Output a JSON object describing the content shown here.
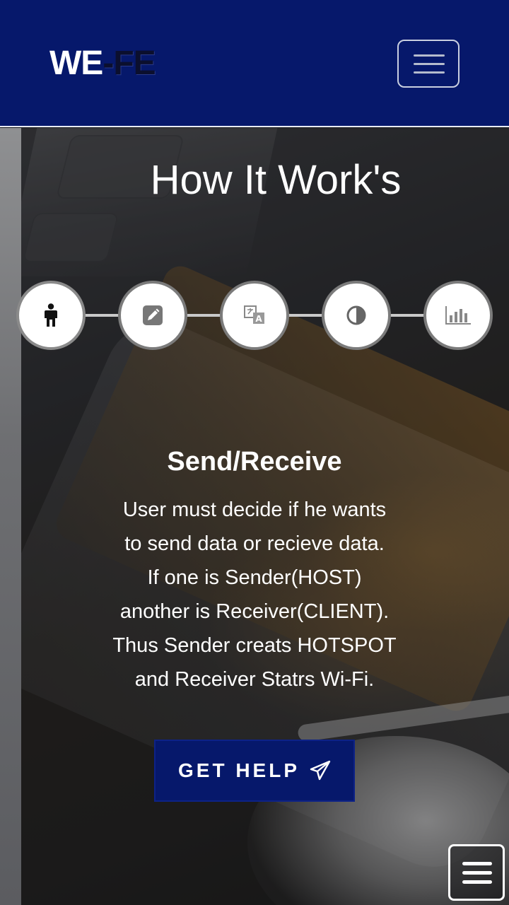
{
  "navbar": {
    "brand_we": "WE",
    "brand_dash": "-",
    "brand_fe": "FE",
    "menu_icon": "hamburger-menu-icon"
  },
  "section": {
    "title": "How It Work's"
  },
  "steps": [
    {
      "icon": "person-icon",
      "active": true
    },
    {
      "icon": "edit-icon",
      "active": false
    },
    {
      "icon": "translate-icon",
      "active": false
    },
    {
      "icon": "contrast-icon",
      "active": false
    },
    {
      "icon": "bar-chart-icon",
      "active": false
    }
  ],
  "active_step": {
    "heading": "Send/Receive",
    "lines": [
      "User must decide if he wants",
      "to send data or recieve data.",
      "If one is Sender(HOST)",
      "another is Receiver(CLIENT).",
      "Thus Sender creats HOTSPOT",
      "and Receiver Statrs Wi-Fi."
    ]
  },
  "cta": {
    "label": "GET HELP",
    "icon": "paper-plane-icon"
  },
  "floating_menu": {
    "icon": "menu-icon"
  },
  "colors": {
    "navbar_bg": "#06186b",
    "cta_bg": "#06186b",
    "text": "#ffffff"
  }
}
